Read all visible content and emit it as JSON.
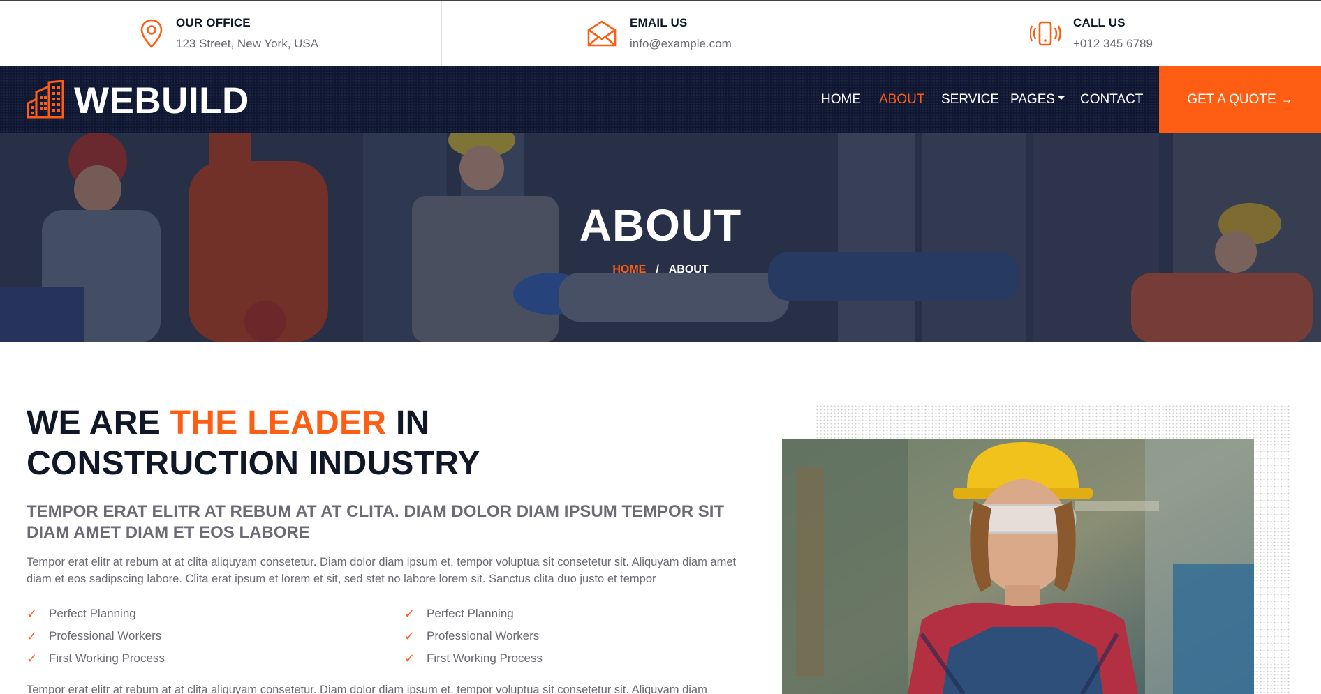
{
  "topbar": {
    "office": {
      "title": "OUR OFFICE",
      "value": "123 Street, New York, USA",
      "icon": "map-pin-icon"
    },
    "email": {
      "title": "EMAIL US",
      "value": "info@example.com",
      "icon": "envelope-icon"
    },
    "call": {
      "title": "CALL US",
      "value": "+012 345 6789",
      "icon": "phone-icon"
    }
  },
  "navbar": {
    "brand": "WEBUILD",
    "links": [
      {
        "label": "HOME"
      },
      {
        "label": "ABOUT",
        "active": true
      },
      {
        "label": "SERVICE"
      },
      {
        "label": "PAGES"
      },
      {
        "label": "CONTACT"
      }
    ],
    "cta": "GET A QUOTE"
  },
  "hero": {
    "title": "ABOUT",
    "breadcrumb_home": "HOME",
    "breadcrumb_sep": "/",
    "breadcrumb_current": "ABOUT"
  },
  "about": {
    "headline_part1": "WE ARE ",
    "headline_highlight": "THE LEADER",
    "headline_part2": " IN CONSTRUCTION INDUSTRY",
    "subhead": "TEMPOR ERAT ELITR AT REBUM AT AT CLITA. DIAM DOLOR DIAM IPSUM TEMPOR SIT DIAM AMET DIAM ET EOS LABORE",
    "paragraph": "Tempor erat elitr at rebum at at clita aliquyam consetetur. Diam dolor diam ipsum et, tempor voluptua sit consetetur sit. Aliquyam diam amet diam et eos sadipscing labore. Clita erat ipsum et lorem et sit, sed stet no labore lorem sit. Sanctus clita duo justo et tempor",
    "features_left": [
      "Perfect Planning",
      "Professional Workers",
      "First Working Process"
    ],
    "features_right": [
      "Perfect Planning",
      "Professional Workers",
      "First Working Process"
    ],
    "paragraph2": "Tempor erat elitr at rebum at at clita aliquyam consetetur. Diam dolor diam ipsum et, tempor voluptua sit consetetur sit. Aliquyam diam"
  },
  "colors": {
    "accent": "#fe5d14",
    "navy": "#0f1733",
    "text_dark": "#101827",
    "text_body": "#6b6a75"
  }
}
